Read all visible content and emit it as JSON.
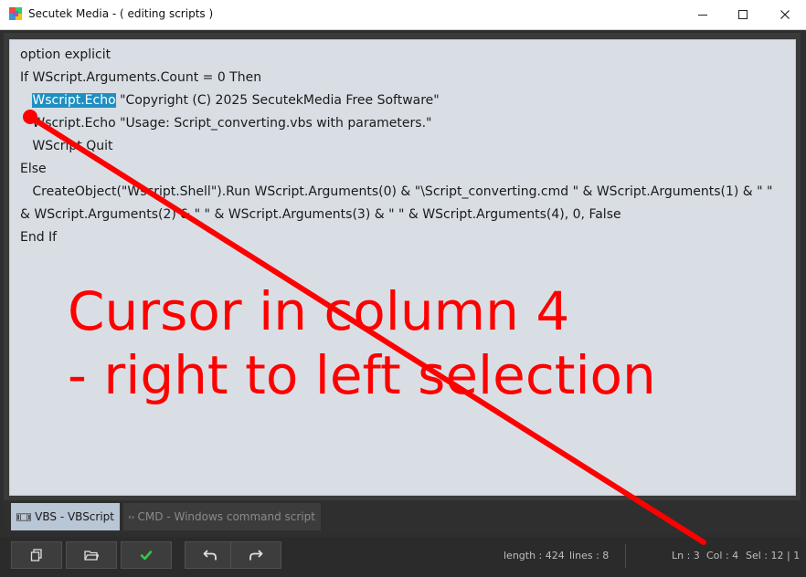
{
  "window": {
    "title": "Secutek Media - ( editing scripts )"
  },
  "editor": {
    "lines": [
      "option explicit",
      "If WScript.Arguments.Count = 0 Then",
      "   ",
      "   Wscript.Echo \"Usage: Script_converting.vbs with parameters.\"",
      "   WScript.Quit",
      "Else",
      "   CreateObject(\"Wscript.Shell\").Run WScript.Arguments(0) & \"\\Script_converting.cmd \" & WScript.Arguments(1) & \" \"",
      "& WScript.Arguments(2) & \" \" & WScript.Arguments(3) & \" \" & WScript.Arguments(4), 0, False",
      "End If"
    ],
    "selected_text": "Wscript.Echo",
    "line3_rest": " \"Copyright (C) 2025 SecutekMedia Free Software\""
  },
  "annotation": {
    "line1": "Cursor in column 4",
    "line2": "- right to left selection",
    "color": "#ff0000"
  },
  "tabs": [
    {
      "label": "VBS - VBScript",
      "active": true
    },
    {
      "label": "CMD - Windows command script",
      "active": false
    }
  ],
  "toolbar": {
    "buttons": [
      {
        "name": "copy-icon"
      },
      {
        "name": "open-folder-icon"
      },
      {
        "name": "check-icon"
      },
      {
        "name": "undo-icon"
      },
      {
        "name": "redo-icon"
      }
    ],
    "accent_check": "#2ecc40"
  },
  "status": {
    "length": "length : 424",
    "lines": "lines : 8",
    "ln": "Ln : 3",
    "col": "Col : 4",
    "sel": "Sel : 12 | 1"
  }
}
